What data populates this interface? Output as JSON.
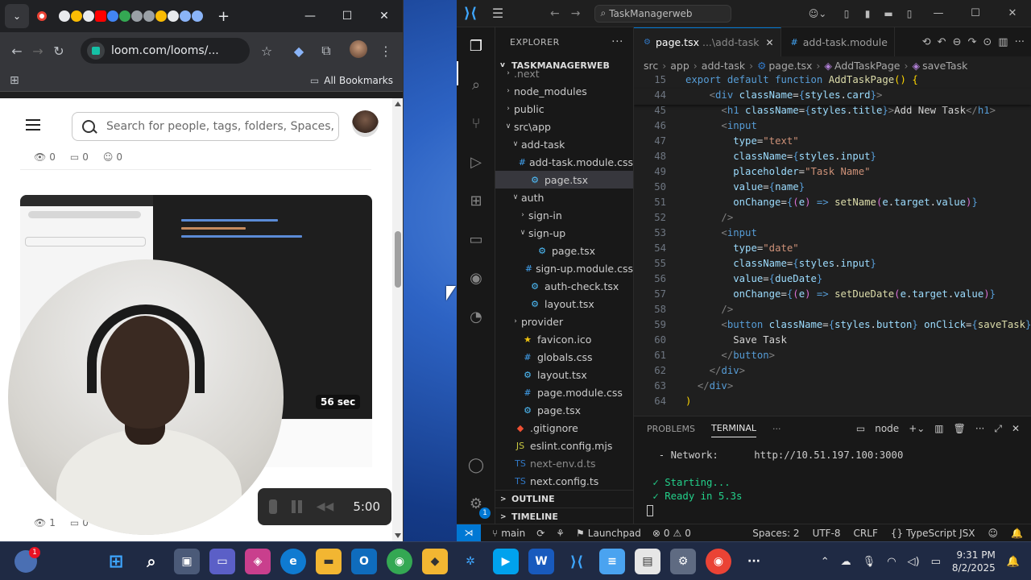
{
  "chrome": {
    "url": "loom.com/looms/...",
    "bookmarks_label": "All Bookmarks"
  },
  "loom": {
    "search_placeholder": "Search for people, tags, folders, Spaces,",
    "top_stats": {
      "views": "0",
      "comments": "0",
      "reactions": "0"
    },
    "video_duration": "56 sec",
    "bottom_stats": {
      "views": "1",
      "comments": "0"
    },
    "recording_time": "5:00"
  },
  "vscode": {
    "search": "TaskManagerweb",
    "explorer_title": "EXPLORER",
    "root": "TASKMANAGERWEB",
    "tree": [
      {
        "label": ".next",
        "depth": 1,
        "chev": ">",
        "icon": "",
        "faded": true
      },
      {
        "label": "node_modules",
        "depth": 1,
        "chev": ">",
        "icon": ""
      },
      {
        "label": "public",
        "depth": 1,
        "chev": ">",
        "icon": ""
      },
      {
        "label": "src\\app",
        "depth": 1,
        "chev": "v",
        "icon": ""
      },
      {
        "label": "add-task",
        "depth": 2,
        "chev": "v",
        "icon": ""
      },
      {
        "label": "add-task.module.css",
        "depth": 3,
        "chev": "",
        "icon": "#"
      },
      {
        "label": "page.tsx",
        "depth": 3,
        "chev": "",
        "icon": "⚙",
        "selected": true
      },
      {
        "label": "auth",
        "depth": 2,
        "chev": "v",
        "icon": ""
      },
      {
        "label": "sign-in",
        "depth": 3,
        "chev": ">",
        "icon": ""
      },
      {
        "label": "sign-up",
        "depth": 3,
        "chev": "v",
        "icon": ""
      },
      {
        "label": "page.tsx",
        "depth": 4,
        "chev": "",
        "icon": "⚙"
      },
      {
        "label": "sign-up.module.css",
        "depth": 4,
        "chev": "",
        "icon": "#"
      },
      {
        "label": "auth-check.tsx",
        "depth": 3,
        "chev": "",
        "icon": "⚙"
      },
      {
        "label": "layout.tsx",
        "depth": 3,
        "chev": "",
        "icon": "⚙"
      },
      {
        "label": "provider",
        "depth": 2,
        "chev": ">",
        "icon": ""
      },
      {
        "label": "favicon.ico",
        "depth": 2,
        "chev": "",
        "icon": "★"
      },
      {
        "label": "globals.css",
        "depth": 2,
        "chev": "",
        "icon": "#"
      },
      {
        "label": "layout.tsx",
        "depth": 2,
        "chev": "",
        "icon": "⚙"
      },
      {
        "label": "page.module.css",
        "depth": 2,
        "chev": "",
        "icon": "#"
      },
      {
        "label": "page.tsx",
        "depth": 2,
        "chev": "",
        "icon": "⚙"
      },
      {
        "label": ".gitignore",
        "depth": 1,
        "chev": "",
        "icon": "◆"
      },
      {
        "label": "eslint.config.mjs",
        "depth": 1,
        "chev": "",
        "icon": "JS"
      },
      {
        "label": "next-env.d.ts",
        "depth": 1,
        "chev": "",
        "icon": "TS",
        "faded": true
      },
      {
        "label": "next.config.ts",
        "depth": 1,
        "chev": "",
        "icon": "TS"
      }
    ],
    "outline": "OUTLINE",
    "timeline": "TIMELINE",
    "tabs": [
      {
        "icon": "⚙",
        "name": "page.tsx",
        "desc": "...\\add-task",
        "active": true
      },
      {
        "icon": "#",
        "name": "add-task.module",
        "desc": "",
        "active": false
      }
    ],
    "breadcrumbs": [
      "src",
      "app",
      "add-task",
      "page.tsx",
      "AddTaskPage",
      "saveTask"
    ],
    "code": [
      {
        "n": "15",
        "html": "<span class='k'>export</span> <span class='k'>default</span> <span class='k'>function</span> <span class='f'>AddTaskPage</span><span class='b'>()</span> <span class='b'>{</span>",
        "sticky": true
      },
      {
        "n": "44",
        "html": "    <span class='p'>&lt;</span><span class='k'>div</span> <span class='v'>className</span>=<span class='k'>{</span><span class='v'>styles</span>.<span class='v'>card</span><span class='k'>}</span><span class='p'>&gt;</span>",
        "sticky": true
      },
      {
        "n": "45",
        "html": "      <span class='p'>&lt;</span><span class='k'>h1</span> <span class='v'>className</span>=<span class='k'>{</span><span class='v'>styles</span>.<span class='v'>title</span><span class='k'>}</span><span class='p'>&gt;</span>Add New Task<span class='p'>&lt;/</span><span class='k'>h1</span><span class='p'>&gt;</span>"
      },
      {
        "n": "46",
        "html": "      <span class='p'>&lt;</span><span class='k'>input</span>"
      },
      {
        "n": "47",
        "html": "        <span class='v'>type</span>=<span class='s'>\"text\"</span>"
      },
      {
        "n": "48",
        "html": "        <span class='v'>className</span>=<span class='k'>{</span><span class='v'>styles</span>.<span class='v'>input</span><span class='k'>}</span>"
      },
      {
        "n": "49",
        "html": "        <span class='v'>placeholder</span>=<span class='s'>\"Task Name\"</span>"
      },
      {
        "n": "50",
        "html": "        <span class='v'>value</span>=<span class='k'>{</span><span class='v'>name</span><span class='k'>}</span>"
      },
      {
        "n": "51",
        "html": "        <span class='v'>onChange</span>=<span class='k'>{</span><span class='br2'>(</span><span class='v'>e</span><span class='br2'>)</span> <span class='k'>=&gt;</span> <span class='f'>setName</span><span class='br2'>(</span><span class='v'>e</span>.<span class='v'>target</span>.<span class='v'>value</span><span class='br2'>)</span><span class='k'>}</span>"
      },
      {
        "n": "52",
        "html": "      <span class='p'>/&gt;</span>"
      },
      {
        "n": "53",
        "html": "      <span class='p'>&lt;</span><span class='k'>input</span>"
      },
      {
        "n": "54",
        "html": "        <span class='v'>type</span>=<span class='s'>\"date\"</span>"
      },
      {
        "n": "55",
        "html": "        <span class='v'>className</span>=<span class='k'>{</span><span class='v'>styles</span>.<span class='v'>input</span><span class='k'>}</span>"
      },
      {
        "n": "56",
        "html": "        <span class='v'>value</span>=<span class='k'>{</span><span class='v'>dueDate</span><span class='k'>}</span>"
      },
      {
        "n": "57",
        "html": "        <span class='v'>onChange</span>=<span class='k'>{</span><span class='br2'>(</span><span class='v'>e</span><span class='br2'>)</span> <span class='k'>=&gt;</span> <span class='f'>setDueDate</span><span class='br2'>(</span><span class='v'>e</span>.<span class='v'>target</span>.<span class='v'>value</span><span class='br2'>)</span><span class='k'>}</span>"
      },
      {
        "n": "58",
        "html": "      <span class='p'>/&gt;</span>"
      },
      {
        "n": "59",
        "html": "      <span class='p'>&lt;</span><span class='k'>button</span> <span class='v'>className</span>=<span class='k'>{</span><span class='v'>styles</span>.<span class='v'>button</span><span class='k'>}</span> <span class='v'>onClick</span>=<span class='k'>{</span><span class='f'>saveTask</span><span class='k'>}</span><span class='p'>&gt;</span>"
      },
      {
        "n": "60",
        "html": "        Save Task"
      },
      {
        "n": "61",
        "html": "      <span class='p'>&lt;/</span><span class='k'>button</span><span class='p'>&gt;</span>"
      },
      {
        "n": "62",
        "html": "    <span class='p'>&lt;/</span><span class='k'>div</span><span class='p'>&gt;</span>"
      },
      {
        "n": "63",
        "html": "  <span class='p'>&lt;/</span><span class='k'>div</span><span class='p'>&gt;</span>"
      },
      {
        "n": "64",
        "html": "<span class='b'>)</span>"
      }
    ],
    "panel": {
      "problems": "PROBLEMS",
      "terminal": "TERMINAL",
      "shell": "node",
      "lines": [
        {
          "label": "  - Network:",
          "value": "      http://10.51.197.100:3000"
        },
        {
          "label": "",
          "value": ""
        },
        {
          "label": " ✓ Starting...",
          "value": ""
        },
        {
          "label": " ✓ Ready in 5.3s",
          "value": ""
        }
      ]
    },
    "status": {
      "branch": "main",
      "launchpad": "Launchpad",
      "errors": "0",
      "warnings": "0",
      "spaces": "Spaces: 2",
      "encoding": "UTF-8",
      "eol": "CRLF",
      "language": "TypeScript JSX",
      "accounts_badge": "1"
    }
  },
  "taskbar": {
    "time": "9:31 PM",
    "date": "8/2/2025",
    "widget_badge": "1"
  },
  "colors": {
    "accent": "#0078d4",
    "loom_teal": "#15c1a6",
    "terminal_ok": "#23d18b"
  }
}
